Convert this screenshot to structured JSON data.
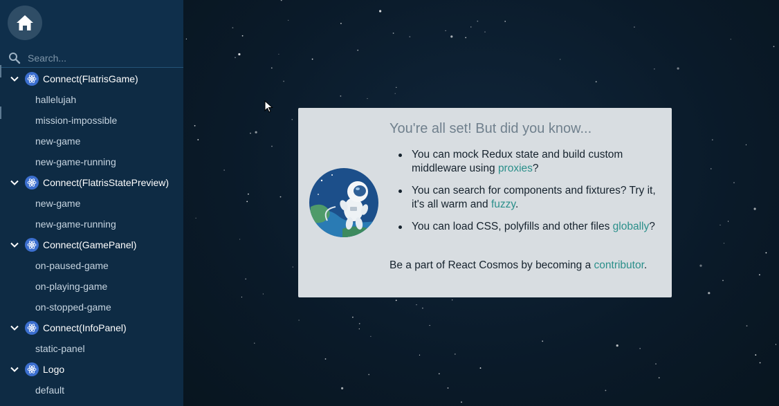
{
  "sidebar": {
    "home_icon": "home-icon",
    "search": {
      "placeholder": "Search...",
      "value": "",
      "icon": "search-icon"
    },
    "components": [
      {
        "name": "Connect(FlatrisGame)",
        "fixtures": [
          "hallelujah",
          "mission-impossible",
          "new-game",
          "new-game-running"
        ]
      },
      {
        "name": "Connect(FlatrisStatePreview)",
        "fixtures": [
          "new-game",
          "new-game-running"
        ]
      },
      {
        "name": "Connect(GamePanel)",
        "fixtures": [
          "on-paused-game",
          "on-playing-game",
          "on-stopped-game"
        ]
      },
      {
        "name": "Connect(InfoPanel)",
        "fixtures": [
          "static-panel"
        ]
      },
      {
        "name": "Logo",
        "fixtures": [
          "default"
        ]
      }
    ]
  },
  "card": {
    "title": "You're all set! But did you know...",
    "tips": [
      {
        "before": "You can mock Redux state and build custom middleware using ",
        "link": "proxies",
        "after": "?"
      },
      {
        "before": "You can search for components and fixtures? Try it, it's all warm and ",
        "link": "fuzzy",
        "after": "."
      },
      {
        "before": "You can load CSS, polyfills and other files ",
        "link": "globally",
        "after": "?"
      }
    ],
    "footer": {
      "before": "Be a part of React Cosmos by becoming a ",
      "link": "contributor",
      "after": "."
    }
  },
  "colors": {
    "sidebar_bg": "#0e2b44",
    "main_bg": "#0b1b2b",
    "card_bg": "#d8dde1",
    "link": "#2a8f8a",
    "react_badge": "#3c6fcf"
  }
}
